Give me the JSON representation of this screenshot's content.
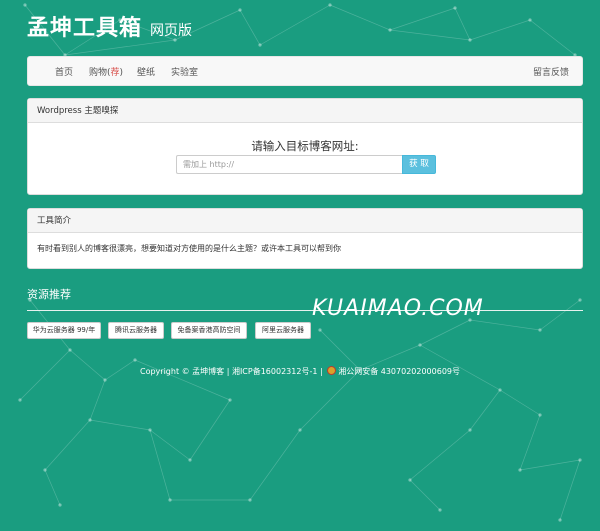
{
  "site": {
    "title": "孟坤工具箱",
    "subtitle": "网页版"
  },
  "nav": {
    "home": "首页",
    "shop_prefix": "购物(",
    "shop_hot": "荐",
    "shop_suffix": ")",
    "wallpaper": "壁纸",
    "lab": "实验室",
    "feedback": "留言反馈"
  },
  "detector": {
    "header": "Wordpress 主题嗅探",
    "prompt": "请输入目标博客网址:",
    "placeholder": "需加上 http://",
    "button": "获 取"
  },
  "intro": {
    "header": "工具简介",
    "text": "有时看到别人的博客很漂亮，想要知道对方使用的是什么主题？或许本工具可以帮到你"
  },
  "resources": {
    "title": "资源推荐",
    "items": [
      "华为云服务器 99/年",
      "腾讯云服务器",
      "免备案香港高防空间",
      "阿里云服务器"
    ]
  },
  "watermark": "KUAIMAO.COM",
  "footer": {
    "copyright": "Copyright © 孟坤博客",
    "sep1": " | ",
    "icp": "湘ICP备16002312号-1",
    "sep2": " | ",
    "police": "湘公网安备 43070202000609号"
  },
  "colors": {
    "background": "#1a9d80",
    "button": "#5bc0de",
    "hot": "#d9534f"
  }
}
